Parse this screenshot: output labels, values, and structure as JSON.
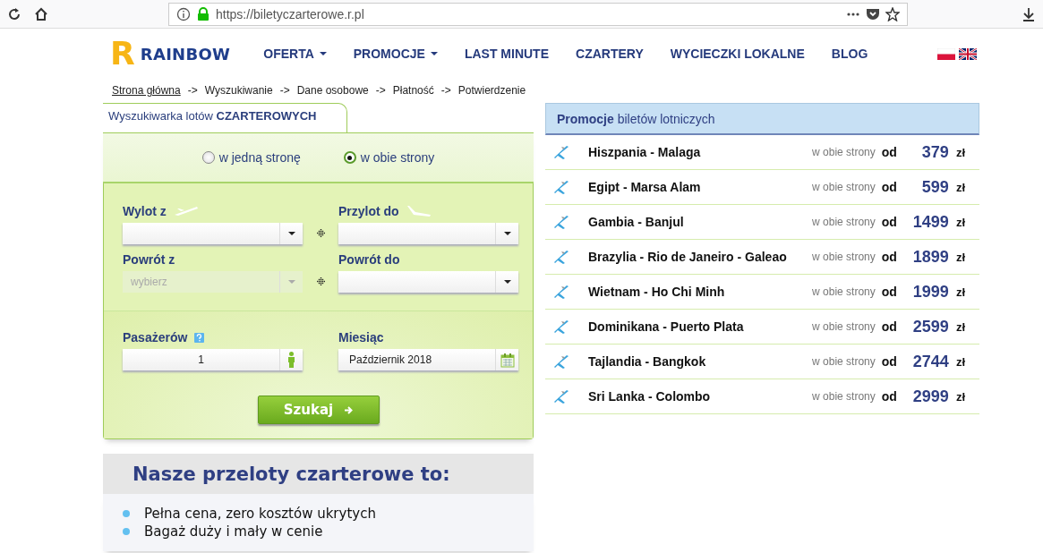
{
  "browser": {
    "url": "https://biletyczarterowe.r.pl"
  },
  "header": {
    "logo": {
      "letter": "R",
      "name": "RAINBOW"
    },
    "nav": [
      {
        "label": "OFERTA",
        "kind": "dropdown"
      },
      {
        "label": "PROMOCJE",
        "kind": "dropdown"
      },
      {
        "label": "LAST MINUTE",
        "kind": "link"
      },
      {
        "label": "CZARTERY",
        "kind": "link"
      },
      {
        "label": "WYCIECZKI LOKALNE",
        "kind": "link"
      },
      {
        "label": "BLOG",
        "kind": "link"
      }
    ],
    "languages": [
      {
        "kind": "pl"
      },
      {
        "kind": "en"
      }
    ]
  },
  "breadcrumb": [
    {
      "label": "Strona główna",
      "kind": "link"
    },
    {
      "label": "->",
      "kind": "separator"
    },
    {
      "label": "Wyszukiwanie",
      "kind": "step"
    },
    {
      "label": "->",
      "kind": "separator"
    },
    {
      "label": "Dane osobowe",
      "kind": "step"
    },
    {
      "label": "->",
      "kind": "separator"
    },
    {
      "label": "Płatność",
      "kind": "step"
    },
    {
      "label": "->",
      "kind": "separator"
    },
    {
      "label": "Potwierdzenie",
      "kind": "step"
    }
  ],
  "search_form": {
    "tab": "Wyszukiwarka lotów **CZARTEROWYCH**",
    "trip_types": [
      {
        "label": "w jedną stronę",
        "selected": false
      },
      {
        "label": "w obie strony",
        "selected": true
      }
    ],
    "routes": [
      {
        "label": "Wylot z",
        "disabled": false
      },
      {
        "label": "Przylot do",
        "disabled": false
      },
      {
        "label": "Powrót z",
        "placeholder": "wybierz",
        "disabled": true
      },
      {
        "label": "Powrót do",
        "disabled": false
      }
    ],
    "passengers": {
      "label": "Pasażerów",
      "value": "1"
    },
    "month": {
      "label": "Miesiąc",
      "value": "Październik 2018"
    },
    "submit": "Szukaj"
  },
  "promotions": {
    "title": "**Promocje** biletów lotniczych",
    "rows": [
      {
        "route": "Hiszpania - Malaga",
        "trip": "w obie strony",
        "from": "od",
        "price": "379",
        "currency": "zł"
      },
      {
        "route": "Egipt - Marsa Alam",
        "trip": "w obie strony",
        "from": "od",
        "price": "599",
        "currency": "zł"
      },
      {
        "route": "Gambia - Banjul",
        "trip": "w obie strony",
        "from": "od",
        "price": "1499",
        "currency": "zł"
      },
      {
        "route": "Brazylia - Rio de Janeiro - Galeao",
        "trip": "w obie strony",
        "from": "od",
        "price": "1899",
        "currency": "zł"
      },
      {
        "route": "Wietnam - Ho Chi Minh",
        "trip": "w obie strony",
        "from": "od",
        "price": "1999",
        "currency": "zł"
      },
      {
        "route": "Dominikana - Puerto Plata",
        "trip": "w obie strony",
        "from": "od",
        "price": "2599",
        "currency": "zł"
      },
      {
        "route": "Tajlandia - Bangkok",
        "trip": "w obie strony",
        "from": "od",
        "price": "2744",
        "currency": "zł"
      },
      {
        "route": "Sri Lanka - Colombo",
        "trip": "w obie strony",
        "from": "od",
        "price": "2999",
        "currency": "zł"
      }
    ]
  },
  "benefits": {
    "title": "Nasze przeloty czarterowe to:",
    "items": [
      "Pełna cena, zero kosztów ukrytych",
      "Bagaż duży i mały w cenie"
    ]
  }
}
